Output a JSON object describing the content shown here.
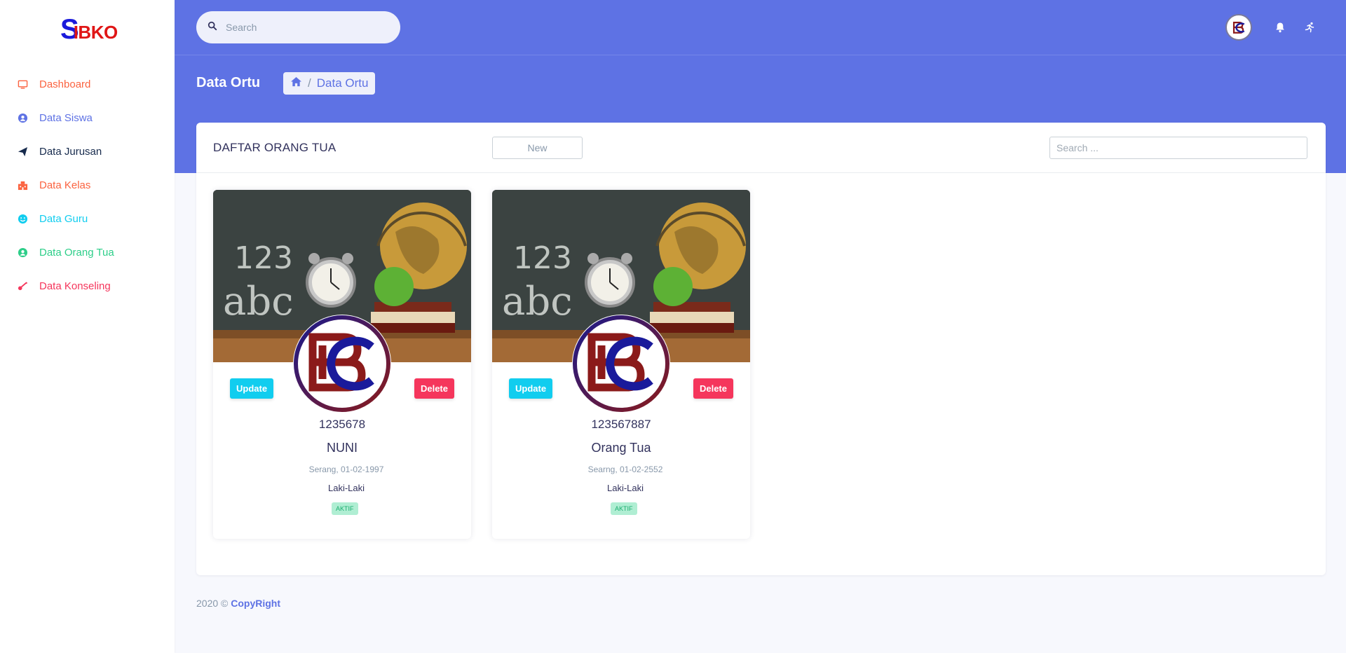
{
  "brand": {
    "logo_first": "S",
    "logo_rest": "IBKO"
  },
  "sidebar": {
    "items": [
      {
        "label": "Dashboard",
        "icon": "monitor-icon",
        "color": "#fb6340"
      },
      {
        "label": "Data Siswa",
        "icon": "user-circle-icon",
        "color": "#5e72e4"
      },
      {
        "label": "Data Jurusan",
        "icon": "send-icon",
        "color": "#172b4d"
      },
      {
        "label": "Data Kelas",
        "icon": "building-icon",
        "color": "#fb6340"
      },
      {
        "label": "Data Guru",
        "icon": "smile-icon",
        "color": "#11cdef"
      },
      {
        "label": "Data Orang Tua",
        "icon": "user-circle-icon",
        "color": "#2dce89"
      },
      {
        "label": "Data Konseling",
        "icon": "key-icon",
        "color": "#f5365c"
      }
    ]
  },
  "topbar": {
    "search_placeholder": "Search",
    "icons": [
      "avatar",
      "bell-icon",
      "running-icon"
    ]
  },
  "header": {
    "title": "Data Ortu",
    "breadcrumb": {
      "home_icon": "home-icon",
      "current": "Data Ortu"
    }
  },
  "panel": {
    "title": "DAFTAR ORANG TUA",
    "new_label": "New",
    "search_placeholder": "Search ..."
  },
  "cards": [
    {
      "id": "1235678",
      "name": "NUNI",
      "ttl": "Serang, 01-02-1997",
      "gender": "Laki-Laki",
      "status": "AKTIF",
      "update_label": "Update",
      "delete_label": "Delete"
    },
    {
      "id": "123567887",
      "name": "Orang Tua",
      "ttl": "Searng, 01-02-2552",
      "gender": "Laki-Laki",
      "status": "AKTIF",
      "update_label": "Update",
      "delete_label": "Delete"
    }
  ],
  "footer": {
    "prefix": "2020 ©",
    "link": "CopyRight"
  },
  "colors": {
    "primary": "#5e72e4",
    "info": "#11cdef",
    "danger": "#f5365c",
    "success": "#2dce89",
    "warning": "#fb6340"
  }
}
